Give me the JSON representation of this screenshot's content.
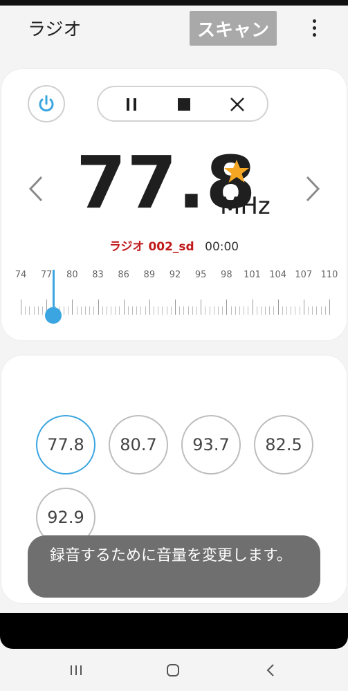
{
  "appbar": {
    "title": "ラジオ",
    "scan_label": "スキャン"
  },
  "tuner": {
    "frequency": "77.8",
    "unit": "MHz",
    "favorite": true,
    "recording_name": "ラジオ 002_sd",
    "recording_time": "00:00",
    "scale_labels": [
      "74",
      "77",
      "80",
      "83",
      "86",
      "89",
      "92",
      "95",
      "98",
      "101",
      "104",
      "107",
      "110"
    ],
    "scale_min": 74,
    "scale_max": 110,
    "current_position": 77.8
  },
  "presets": [
    "77.8",
    "80.7",
    "93.7",
    "82.5",
    "92.9"
  ],
  "toast": {
    "message": "録音するために音量を変更します。"
  },
  "colors": {
    "accent": "#3aa5e0",
    "star": "#f5a623",
    "record_name": "#c01a1a",
    "scan_button": "#a9a9a9"
  }
}
